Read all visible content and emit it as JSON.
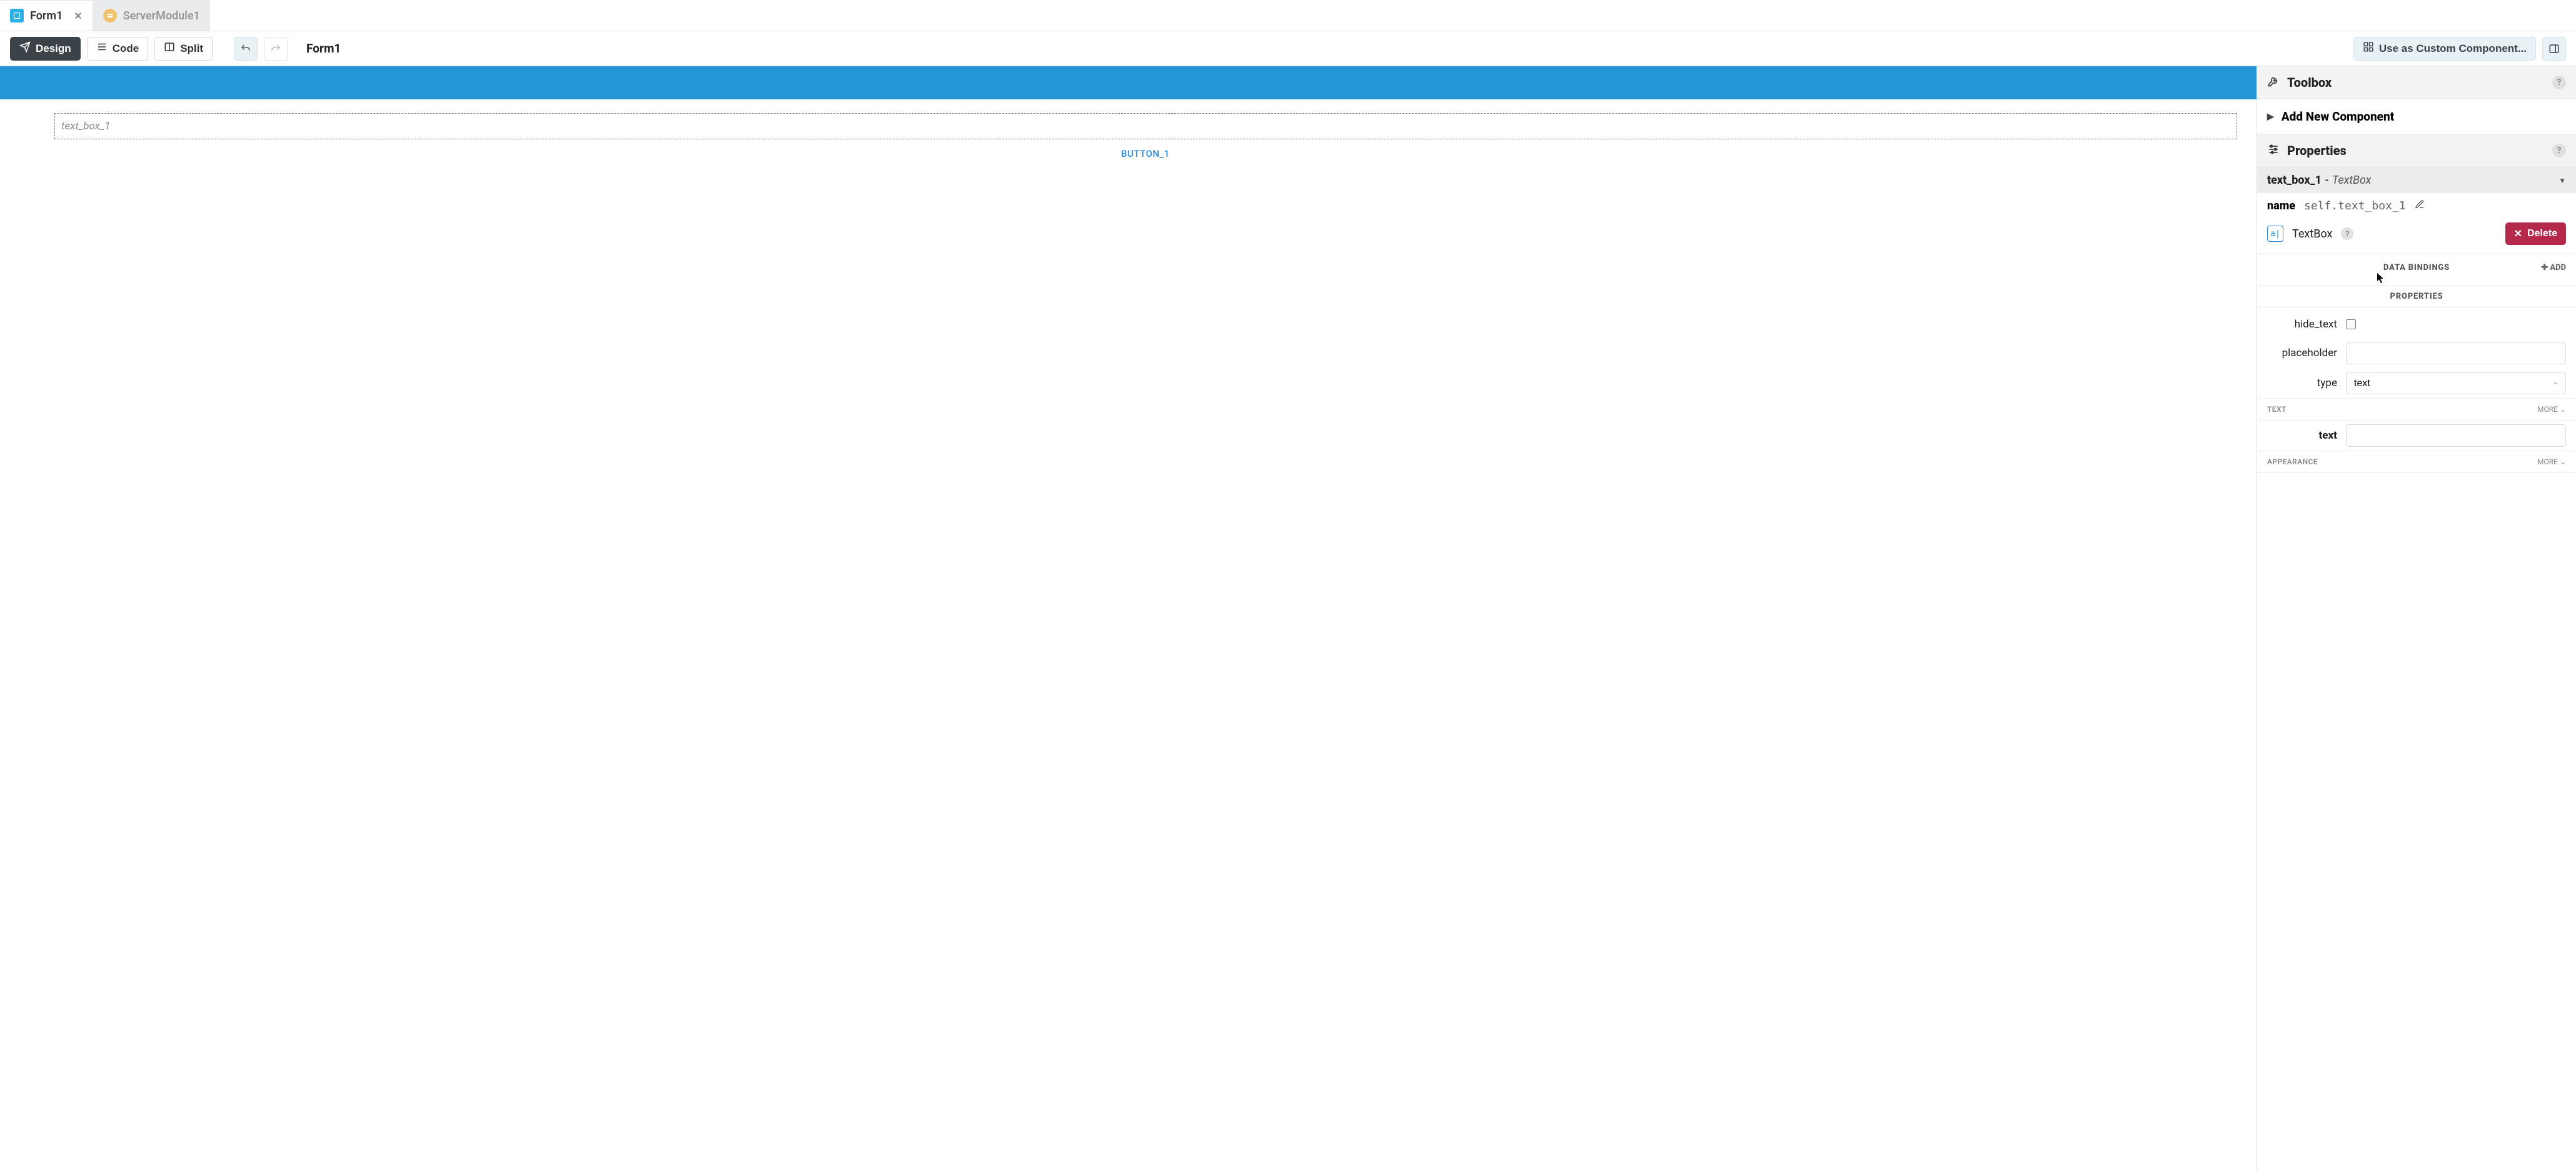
{
  "tabs": [
    {
      "label": "Form1",
      "active": true
    },
    {
      "label": "ServerModule1",
      "active": false
    }
  ],
  "toolbar": {
    "design": "Design",
    "code": "Code",
    "split": "Split",
    "title": "Form1",
    "use_custom": "Use as Custom Component..."
  },
  "canvas": {
    "textbox_placeholder": "text_box_1",
    "button_label": "BUTTON_1"
  },
  "toolbox": {
    "title": "Toolbox",
    "add_new": "Add New Component"
  },
  "properties": {
    "title": "Properties",
    "selected_name": "text_box_1",
    "selected_type": "TextBox",
    "name_label": "name",
    "name_value": "self.text_box_1",
    "type_tile": "a|",
    "type_name": "TextBox",
    "delete": "Delete",
    "data_bindings": "DATA BINDINGS",
    "add": "ADD",
    "properties_heading": "PROPERTIES",
    "hide_text_label": "hide_text",
    "placeholder_label": "placeholder",
    "placeholder_value": "",
    "type_label": "type",
    "type_value": "text",
    "text_section": "TEXT",
    "more": "MORE",
    "text_label": "text",
    "text_value": "",
    "appearance_section": "APPEARANCE"
  }
}
